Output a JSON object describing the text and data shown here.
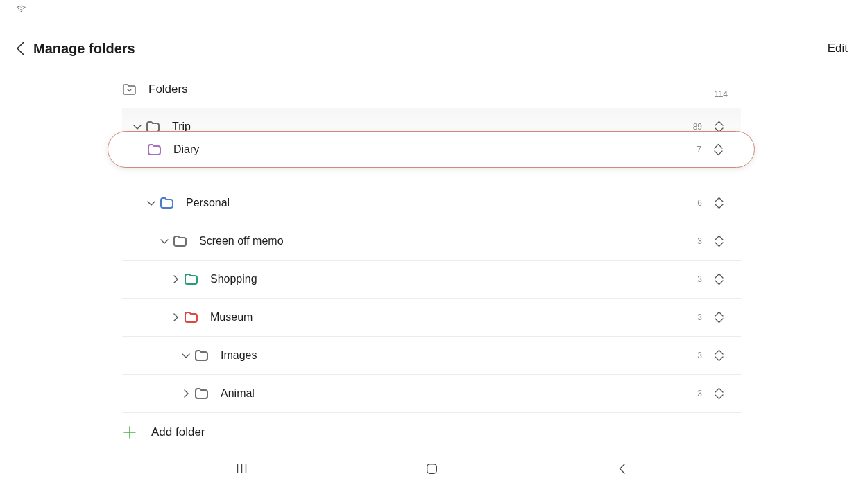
{
  "title_bar": {
    "title": "Manage folders",
    "action": "Edit"
  },
  "folders": {
    "name": "Folders",
    "count": "114",
    "children": [
      {
        "name": "Trip",
        "count": "89",
        "color": "#6e6e6e",
        "expanded": true,
        "children": [
          {
            "name": "Diary",
            "count": "7",
            "color": "#a86cc1",
            "dragging": true
          },
          {
            "name": "Personal",
            "count": "6",
            "color": "#4a7cc9",
            "expanded": true,
            "children": [
              {
                "name": "Screen off memo",
                "count": "3",
                "color": "#6e6e6e",
                "expanded": true,
                "children": [
                  {
                    "name": "Shopping",
                    "count": "3",
                    "color": "#2b9a7b",
                    "expanded": false
                  },
                  {
                    "name": "Museum",
                    "count": "3",
                    "color": "#dc4a3f",
                    "expanded": false,
                    "children": [
                      {
                        "name": "Images",
                        "count": "3",
                        "color": "#6e6e6e",
                        "expanded": true
                      },
                      {
                        "name": "Animal",
                        "count": "3",
                        "color": "#6e6e6e",
                        "expanded": false
                      }
                    ]
                  }
                ]
              }
            ]
          }
        ]
      }
    ]
  },
  "add_folder": {
    "label": "Add folder"
  }
}
